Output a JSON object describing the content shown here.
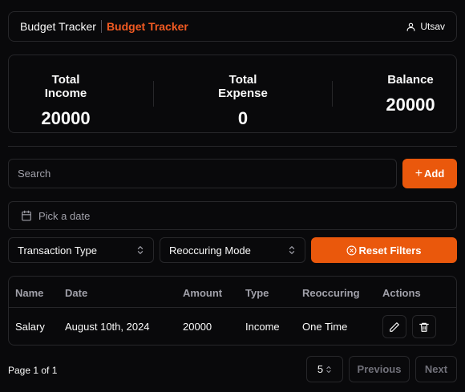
{
  "header": {
    "brand_primary": "Budget Tracker",
    "brand_accent": "Budget Tracker",
    "user_name": "Utsav",
    "user_icon": "user-icon"
  },
  "stats": {
    "income_label": "Total Income",
    "income_value": "20000",
    "expense_label": "Total Expense",
    "expense_value": "0",
    "balance_label": "Balance",
    "balance_value": "20000"
  },
  "search": {
    "placeholder": "Search",
    "value": ""
  },
  "add_button": {
    "label": "Add",
    "icon": "plus-icon"
  },
  "date_picker": {
    "placeholder": "Pick a date",
    "icon": "calendar-icon"
  },
  "filters": {
    "type_select": "Transaction Type",
    "mode_select": "Reoccuring Mode",
    "reset_label": "Reset Filters",
    "reset_icon": "circle-x-icon"
  },
  "table": {
    "columns": [
      "Name",
      "Date",
      "Amount",
      "Type",
      "Reoccuring",
      "Actions"
    ],
    "rows": [
      {
        "name": "Salary",
        "date": "August 10th, 2024",
        "amount": "20000",
        "type": "Income",
        "reoccuring": "One Time"
      }
    ]
  },
  "pagination": {
    "info": "Page 1 of 1",
    "page_size": "5",
    "previous": "Previous",
    "next": "Next"
  },
  "colors": {
    "accent": "#ea580c",
    "brand_accent": "#f15a22",
    "background": "#09090b",
    "border": "#27272a"
  }
}
